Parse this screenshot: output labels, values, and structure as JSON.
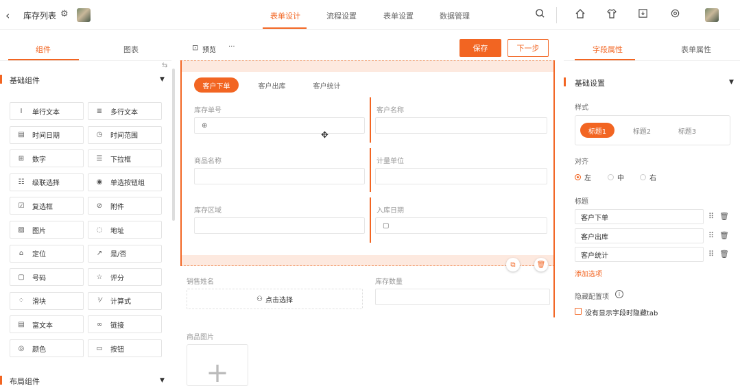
{
  "header": {
    "back_icon": "‹",
    "title": "库存列表",
    "tabs": [
      {
        "label": "表单设计",
        "active": true
      },
      {
        "label": "流程设置",
        "active": false
      },
      {
        "label": "表单设置",
        "active": false
      },
      {
        "label": "数据管理",
        "active": false
      }
    ],
    "icons": [
      "search-icon",
      "home-icon",
      "shirt-icon",
      "download-icon",
      "settings-icon"
    ]
  },
  "left_panel": {
    "tabs": [
      {
        "label": "组件",
        "active": true
      },
      {
        "label": "图表",
        "active": false
      }
    ],
    "sort_icon": "⇆",
    "basic_section": "基础组件",
    "components": [
      {
        "icon": "I",
        "label": "单行文本",
        "name": "single-line-text"
      },
      {
        "icon": "≣",
        "label": "多行文本",
        "name": "multi-line-text"
      },
      {
        "icon": "▤",
        "label": "时间日期",
        "name": "date-time"
      },
      {
        "icon": "◷",
        "label": "时间范围",
        "name": "time-range"
      },
      {
        "icon": "⊞",
        "label": "数字",
        "name": "number"
      },
      {
        "icon": "☰",
        "label": "下拉框",
        "name": "dropdown"
      },
      {
        "icon": "☷",
        "label": "级联选择",
        "name": "cascade-select"
      },
      {
        "icon": "◉",
        "label": "单选按钮组",
        "name": "radio-group"
      },
      {
        "icon": "☑",
        "label": "复选框",
        "name": "checkbox"
      },
      {
        "icon": "⊘",
        "label": "附件",
        "name": "attachment"
      },
      {
        "icon": "▨",
        "label": "图片",
        "name": "image"
      },
      {
        "icon": "◌",
        "label": "地址",
        "name": "address"
      },
      {
        "icon": "⌂",
        "label": "定位",
        "name": "location"
      },
      {
        "icon": "↗",
        "label": "是/否",
        "name": "yes-no"
      },
      {
        "icon": "▢",
        "label": "号码",
        "name": "phone"
      },
      {
        "icon": "☆",
        "label": "评分",
        "name": "rating"
      },
      {
        "icon": "⁘",
        "label": "滑块",
        "name": "slider"
      },
      {
        "icon": "⅟",
        "label": "计算式",
        "name": "formula"
      },
      {
        "icon": "▤",
        "label": "富文本",
        "name": "rich-text"
      },
      {
        "icon": "∞",
        "label": "链接",
        "name": "link"
      },
      {
        "icon": "◎",
        "label": "颜色",
        "name": "color"
      },
      {
        "icon": "▭",
        "label": "按钮",
        "name": "button"
      }
    ],
    "layout_section": "布局组件"
  },
  "toolbar": {
    "preview_label": "预览",
    "more_label": "···",
    "save_label": "保存",
    "next_label": "下一步"
  },
  "canvas": {
    "tabs": [
      {
        "label": "客户下单",
        "active": true
      },
      {
        "label": "客户出库",
        "active": false
      },
      {
        "label": "客户统计",
        "active": false
      }
    ],
    "fields": [
      {
        "label": "库存单号",
        "value": "⊕"
      },
      {
        "label": "客户名称",
        "value": ""
      },
      {
        "label": "商品名称",
        "value": ""
      },
      {
        "label": "计量单位",
        "value": ""
      },
      {
        "label": "库存区域",
        "value": ""
      },
      {
        "label": "入库日期",
        "value": "▢"
      }
    ],
    "sales_person_label": "销售姓名",
    "select_label": "点击选择",
    "stock_qty_label": "库存数量",
    "product_image_label": "商品图片",
    "upload_plus": "+"
  },
  "right_panel": {
    "tabs": [
      {
        "label": "字段属性",
        "active": true
      },
      {
        "label": "表单属性",
        "active": false
      }
    ],
    "basic_settings": "基础设置",
    "style_label": "样式",
    "style_options": [
      {
        "label": "标题1",
        "active": true
      },
      {
        "label": "标题2",
        "active": false
      },
      {
        "label": "标题3",
        "active": false
      }
    ],
    "align_label": "对齐",
    "align_options": [
      {
        "label": "左",
        "active": true
      },
      {
        "label": "中",
        "active": false
      },
      {
        "label": "右",
        "active": false
      }
    ],
    "title_label": "标题",
    "title_options": [
      "客户下单",
      "客户出库",
      "客户统计"
    ],
    "add_option": "添加选项",
    "hidden_config": "隐藏配置项",
    "checkbox_label": "没有显示字段时隐藏tab"
  }
}
